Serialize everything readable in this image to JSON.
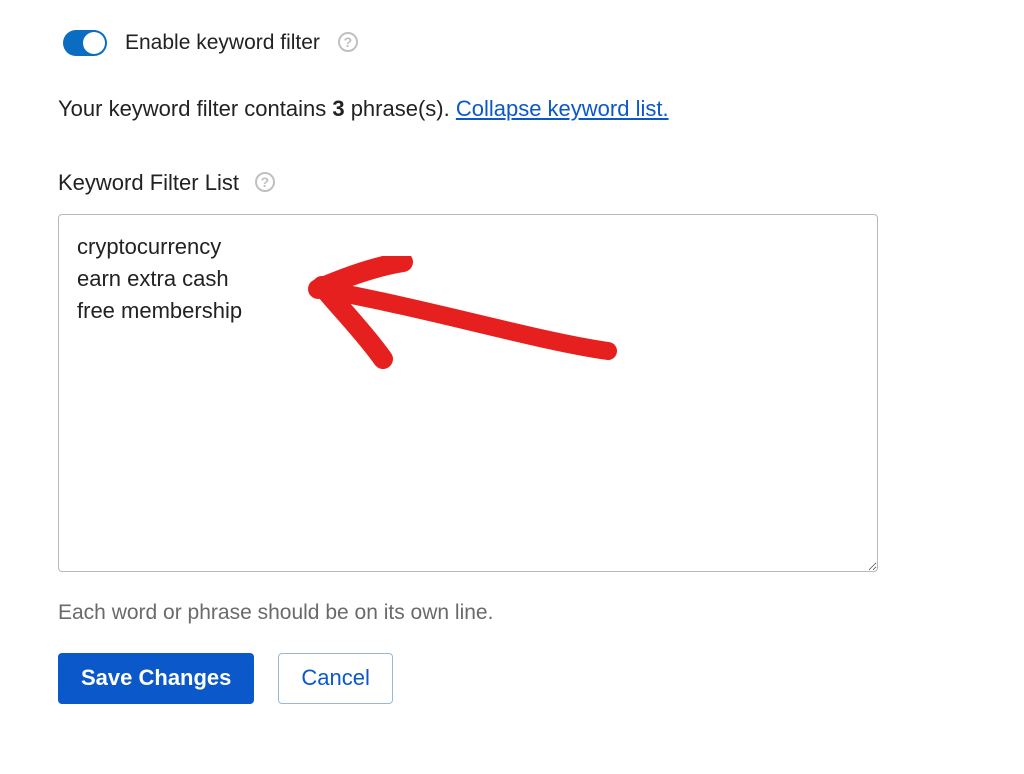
{
  "toggle": {
    "label": "Enable keyword filter",
    "enabled": true
  },
  "summary": {
    "prefix": "Your keyword filter contains ",
    "count": "3",
    "suffix": " phrase(s). ",
    "collapse_link": "Collapse keyword list."
  },
  "list": {
    "label": "Keyword Filter List",
    "value": "cryptocurrency\nearn extra cash\nfree membership",
    "hint": "Each word or phrase should be on its own line."
  },
  "buttons": {
    "save": "Save Changes",
    "cancel": "Cancel"
  },
  "annotation": {
    "color": "#e6201e"
  }
}
